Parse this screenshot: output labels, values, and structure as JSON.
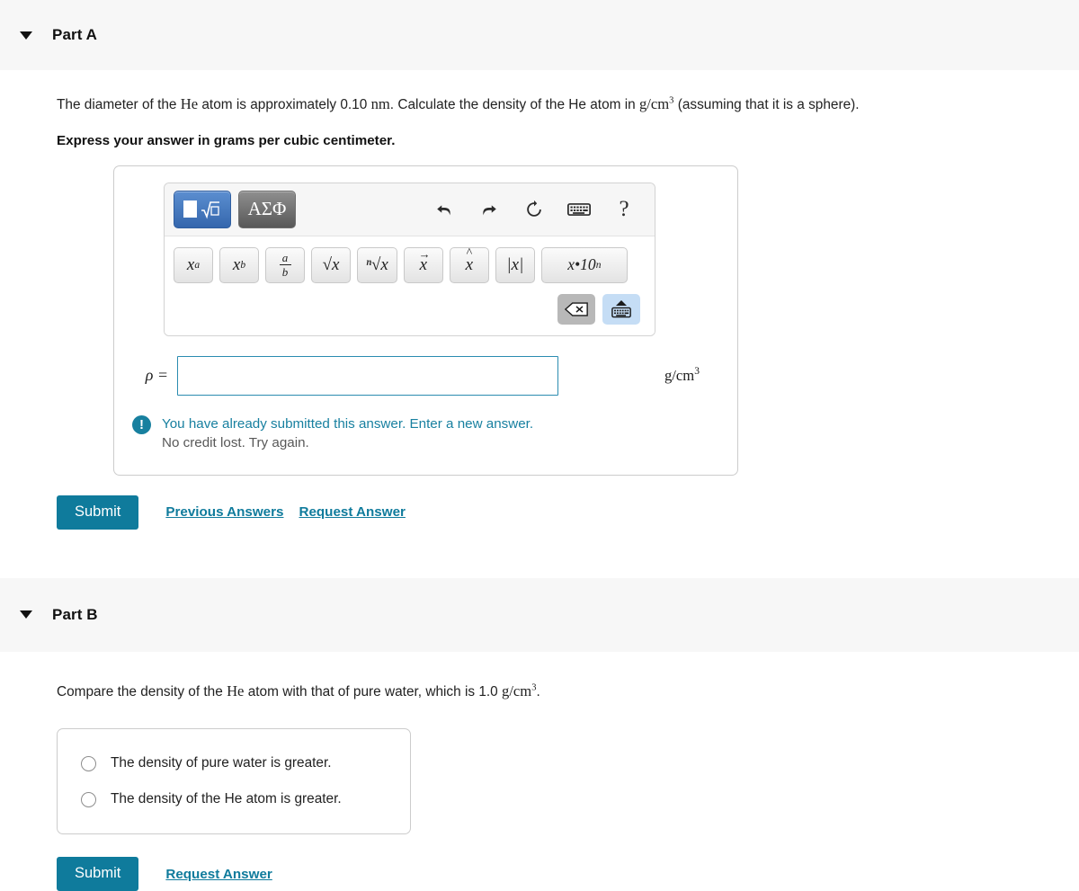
{
  "parts": [
    {
      "id": "part-a",
      "title": "Part A",
      "disclosure": "triangle-down-icon",
      "question": {
        "pre": "The diameter of the ",
        "el": "He",
        "mid": " atom is approximately 0.10 ",
        "unit_nm": "nm",
        "mid2": ". Calculate the density of the He atom in ",
        "unit_gcm": "g/cm",
        "unit_exp": "3",
        "post": " (assuming that it is a sphere)."
      },
      "instruction": "Express your answer in grams per cubic centimeter.",
      "math_toolbar": {
        "template_button": "template-icon",
        "greek_button": "ΑΣΦ",
        "undo": "undo-icon",
        "redo": "redo-icon",
        "reset": "reset-icon",
        "keyboard": "keyboard-icon",
        "help": "?",
        "keys": [
          {
            "name": "power",
            "base": "x",
            "sup": "a"
          },
          {
            "name": "subscript",
            "base": "x",
            "sub": "b"
          },
          {
            "name": "fraction",
            "num": "a",
            "den": "b"
          },
          {
            "name": "square-root",
            "label": "√x"
          },
          {
            "name": "nth-root",
            "label": "ⁿ√x"
          },
          {
            "name": "vector",
            "label": "x"
          },
          {
            "name": "hat",
            "label": "x"
          },
          {
            "name": "absolute-value",
            "label": "|x|"
          },
          {
            "name": "scientific-notation",
            "label": "x•10",
            "sup": "n"
          }
        ],
        "backspace": "backspace-icon",
        "keyboard_toggle": "keyboard-up-icon"
      },
      "answer": {
        "label": "ρ =",
        "value": "",
        "placeholder": "",
        "units": "g/cm",
        "units_exp": "3"
      },
      "feedback": {
        "icon": "exclamation-icon",
        "line1": "You have already submitted this answer. Enter a new answer.",
        "line2": "No credit lost. Try again."
      },
      "actions": {
        "submit": "Submit",
        "links": [
          "Previous Answers",
          "Request Answer"
        ]
      }
    },
    {
      "id": "part-b",
      "title": "Part B",
      "disclosure": "triangle-down-icon",
      "question": {
        "pre": "Compare the density of the ",
        "el": "He",
        "mid": " atom with that of pure water, which is 1.0 ",
        "unit_gcm": "g/cm",
        "unit_exp": "3",
        "post": "."
      },
      "choices": [
        {
          "name": "choice-water-greater",
          "label": "The density of pure water is greater.",
          "selected": false
        },
        {
          "name": "choice-he-greater",
          "label": "The density of the He atom is greater.",
          "selected": false
        }
      ],
      "actions": {
        "submit": "Submit",
        "links": [
          "Request Answer"
        ]
      }
    }
  ],
  "colors": {
    "accent_teal": "#0f7b9c",
    "feedback_teal": "#1880a0",
    "input_border": "#2b8cb0",
    "header_band": "#f7f7f7",
    "template_blue": "#3567ad"
  }
}
